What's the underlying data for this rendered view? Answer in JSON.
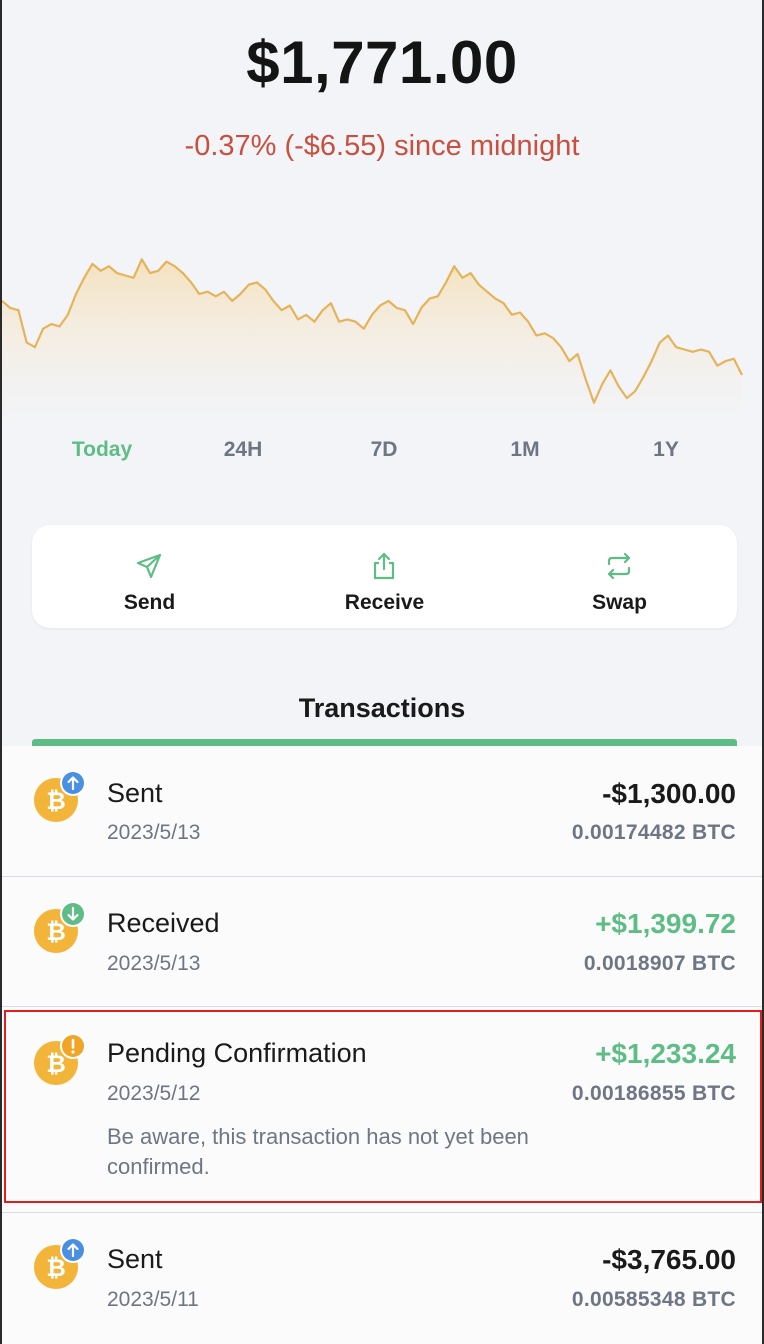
{
  "wallet": {
    "balance": "$1,771.00",
    "change_text": "-0.37% (-$6.55) since midnight"
  },
  "colors": {
    "accent": "#5dbd85",
    "negative": "#c8503e",
    "chart_line": "#e4b35a",
    "arrow_up_badge": "#4a90e2",
    "arrow_down_badge": "#5dbd85",
    "warning_badge": "#f0a526",
    "bitcoin": "#f3b43a"
  },
  "range_tabs": [
    {
      "label": "Today",
      "active": true
    },
    {
      "label": "24H",
      "active": false
    },
    {
      "label": "7D",
      "active": false
    },
    {
      "label": "1M",
      "active": false
    },
    {
      "label": "1Y",
      "active": false
    }
  ],
  "actions": [
    {
      "label": "Send",
      "icon": "send-icon"
    },
    {
      "label": "Receive",
      "icon": "share-icon"
    },
    {
      "label": "Swap",
      "icon": "swap-icon"
    }
  ],
  "transactions_header": "Transactions",
  "transactions": [
    {
      "title": "Sent",
      "date": "2023/5/13",
      "amount": "-$1,300.00",
      "btc": "0.00174482 BTC",
      "badge": "arrow-up-icon",
      "positive": false,
      "note": ""
    },
    {
      "title": "Received",
      "date": "2023/5/13",
      "amount": "+$1,399.72",
      "btc": "0.0018907 BTC",
      "badge": "arrow-down-icon",
      "positive": true,
      "note": ""
    },
    {
      "title": "Pending Confirmation",
      "date": "2023/5/12",
      "amount": "+$1,233.24",
      "btc": "0.00186855 BTC",
      "badge": "warning-icon",
      "positive": true,
      "note": "Be aware, this transaction has not yet been confirmed."
    },
    {
      "title": "Sent",
      "date": "2023/5/11",
      "amount": "-$3,765.00",
      "btc": "0.00585348 BTC",
      "badge": "arrow-up-icon",
      "positive": false,
      "note": ""
    }
  ],
  "chart_data": {
    "type": "area",
    "series": [
      {
        "values": [
          58,
          55,
          54,
          40,
          38,
          46,
          48,
          47,
          52,
          61,
          68,
          74,
          71,
          73,
          70,
          69,
          68,
          76,
          70,
          71,
          75,
          73,
          70,
          66,
          61,
          62,
          60,
          62,
          58,
          61,
          65,
          66,
          63,
          58,
          54,
          56,
          50,
          52,
          49,
          54,
          57,
          49,
          50,
          49,
          46,
          52,
          56,
          58,
          55,
          54,
          48,
          55,
          59,
          60,
          66,
          73,
          68,
          70,
          65,
          62,
          59,
          57,
          52,
          53,
          49,
          43,
          44,
          42,
          38,
          32,
          35,
          24,
          14,
          22,
          28,
          21,
          16,
          19,
          25,
          32,
          40,
          43,
          38,
          37,
          36,
          37,
          36,
          30,
          32,
          33,
          26
        ]
      }
    ]
  }
}
